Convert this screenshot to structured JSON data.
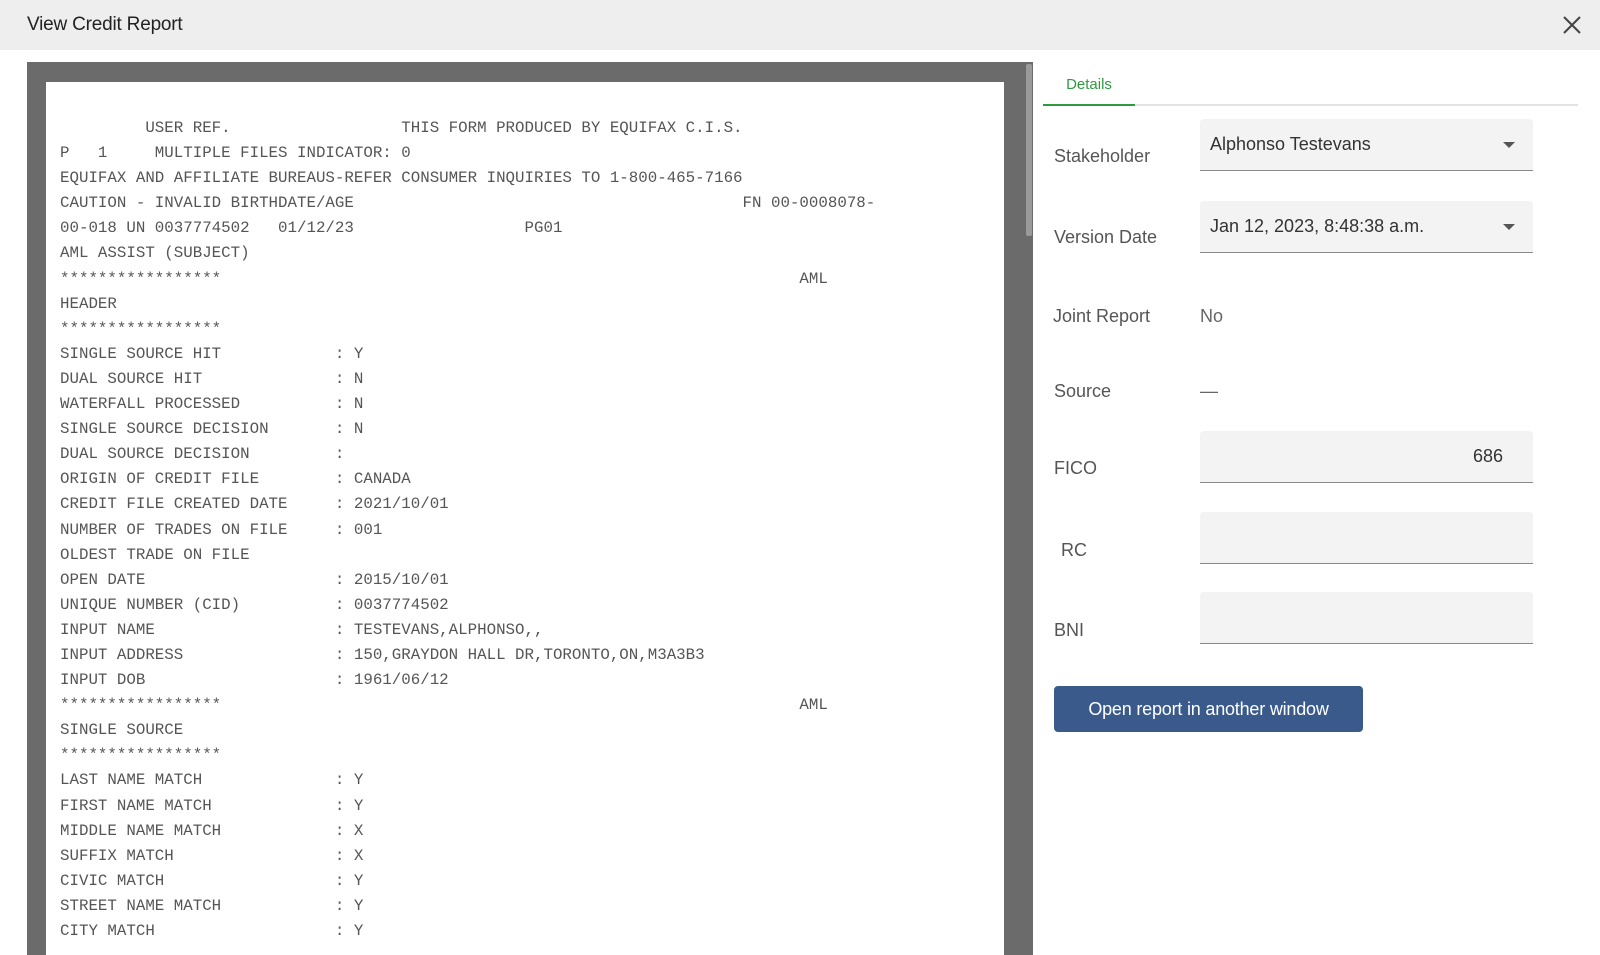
{
  "window": {
    "title": "View Credit Report",
    "close_icon": "close-icon"
  },
  "report": {
    "lines": [
      "         USER REF.                  THIS FORM PRODUCED BY EQUIFAX C.I.S.",
      "P   1     MULTIPLE FILES INDICATOR: 0",
      "EQUIFAX AND AFFILIATE BUREAUS-REFER CONSUMER INQUIRIES TO 1-800-465-7166",
      "CAUTION - INVALID BIRTHDATE/AGE                                         FN 00-0008078-",
      "00-018 UN 0037774502   01/12/23                  PG01",
      "AML ASSIST (SUBJECT)",
      "*****************                                                             AML",
      "HEADER",
      "*****************",
      "SINGLE SOURCE HIT            : Y",
      "DUAL SOURCE HIT              : N",
      "WATERFALL PROCESSED          : N",
      "SINGLE SOURCE DECISION       : N",
      "DUAL SOURCE DECISION         :",
      "ORIGIN OF CREDIT FILE        : CANADA",
      "CREDIT FILE CREATED DATE     : 2021/10/01",
      "NUMBER OF TRADES ON FILE     : 001",
      "OLDEST TRADE ON FILE",
      "OPEN DATE                    : 2015/10/01",
      "UNIQUE NUMBER (CID)          : 0037774502",
      "INPUT NAME                   : TESTEVANS,ALPHONSO,,",
      "INPUT ADDRESS                : 150,GRAYDON HALL DR,TORONTO,ON,M3A3B3",
      "INPUT DOB                    : 1961/06/12",
      "*****************                                                             AML",
      "SINGLE SOURCE",
      "*****************",
      "LAST NAME MATCH              : Y",
      "FIRST NAME MATCH             : Y",
      "MIDDLE NAME MATCH            : X",
      "SUFFIX MATCH                 : X",
      "CIVIC MATCH                  : Y",
      "STREET NAME MATCH            : Y",
      "CITY MATCH                   : Y"
    ]
  },
  "panel": {
    "tabs": [
      {
        "label": "Details",
        "active": true
      }
    ],
    "stakeholder": {
      "label": "Stakeholder",
      "value": "Alphonso Testevans"
    },
    "version_date": {
      "label": "Version Date",
      "value": "Jan 12, 2023, 8:48:38 a.m."
    },
    "joint_report": {
      "label": "Joint Report",
      "value": "No"
    },
    "source": {
      "label": "Source",
      "value": "—"
    },
    "fico": {
      "label": "FICO",
      "value": "686"
    },
    "rc": {
      "label": "RC",
      "value": ""
    },
    "bni": {
      "label": "BNI",
      "value": ""
    },
    "open_button": "Open report in another window"
  },
  "colors": {
    "accent_green": "#2e9b41",
    "button_blue": "#3a5a8c",
    "viewer_gray": "#6b6b6b"
  }
}
